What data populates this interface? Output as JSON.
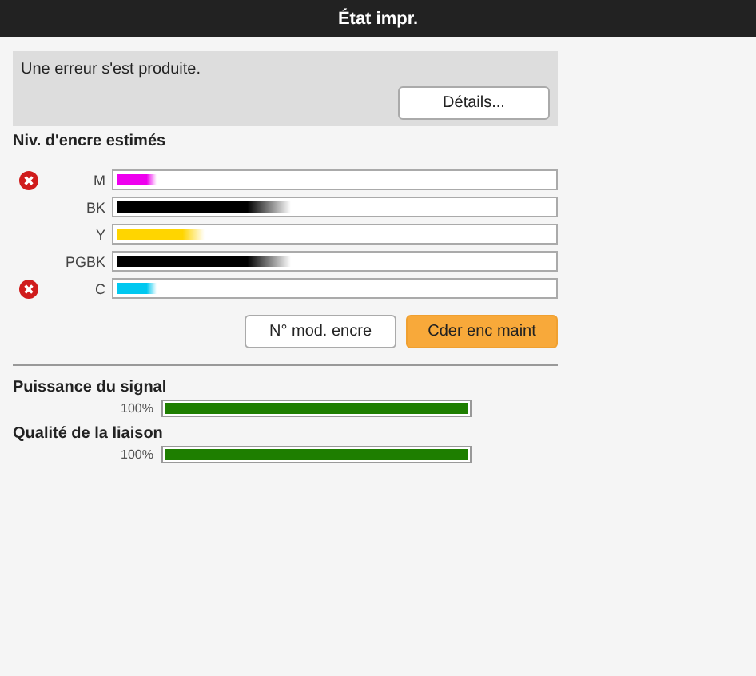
{
  "window": {
    "title": "État impr."
  },
  "error_panel": {
    "message": "Une erreur s'est produite.",
    "button": "Détails..."
  },
  "ink_section": {
    "title": "Niv. d'encre estimés",
    "inks": [
      {
        "name": "M",
        "color": "#ee00ee",
        "level": 0.09,
        "error": true
      },
      {
        "name": "BK",
        "color": "#000000",
        "level": 0.4,
        "error": false
      },
      {
        "name": "Y",
        "color": "#ffd500",
        "level": 0.2,
        "error": false
      },
      {
        "name": "PGBK",
        "color": "#000000",
        "level": 0.4,
        "error": false
      },
      {
        "name": "C",
        "color": "#00c8f0",
        "level": 0.09,
        "error": true
      }
    ],
    "buttons": [
      {
        "label": "N° mod. encre",
        "kind": "plain"
      },
      {
        "label": "Cder enc maint",
        "kind": "primary"
      }
    ]
  },
  "meters": [
    {
      "title": "Puissance du signal",
      "reading": "100%",
      "level": 1
    },
    {
      "title": "Qualité de la liaison",
      "reading": "100%",
      "level": 1
    }
  ]
}
